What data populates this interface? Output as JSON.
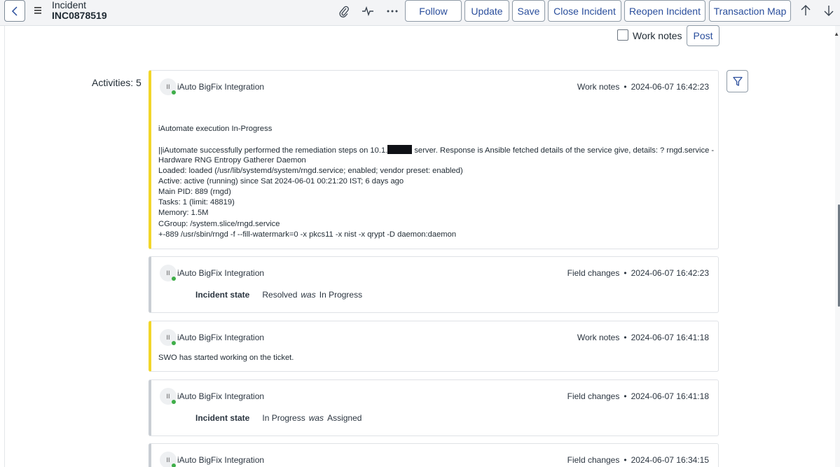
{
  "header": {
    "title": "Incident",
    "number": "INC0878519",
    "buttons": {
      "follow": "Follow",
      "update": "Update",
      "save": "Save",
      "close_incident": "Close Incident",
      "reopen_incident": "Reopen Incident",
      "transaction_map": "Transaction Map"
    },
    "icons": [
      "back-icon",
      "menu-icon",
      "paperclip-icon",
      "pulse-icon",
      "more-icon",
      "arrow-up-icon",
      "arrow-down-icon"
    ]
  },
  "compose": {
    "work_notes_label": "Work notes",
    "work_notes_checked": false,
    "post_label": "Post"
  },
  "activities": {
    "label": "Activities: 5",
    "entries": [
      {
        "avatar": "II",
        "author": "iAuto BigFix Integration",
        "type": "Work notes",
        "timestamp": "2024-06-07 16:42:23",
        "title": "iAutomate execution In-Progress",
        "line1_before": "||iAutomate successfully performed the remediation steps on 10.1.",
        "line1_after": "server. Response is Ansible fetched details of the service give, details: ? rngd.service -",
        "lines": [
          "Hardware RNG Entropy Gatherer Daemon",
          "Loaded: loaded (/usr/lib/systemd/system/rngd.service; enabled; vendor preset: enabled)",
          "Active: active (running) since Sat 2024-06-01 00:21:20 IST; 6 days ago",
          "Main PID: 889 (rngd)",
          "Tasks: 1 (limit: 48819)",
          "Memory: 1.5M",
          "CGroup: /system.slice/rngd.service",
          "+-889 /usr/sbin/rngd -f --fill-watermark=0 -x pkcs11 -x nist -x qrypt -D daemon:daemon"
        ]
      },
      {
        "avatar": "II",
        "author": "iAuto BigFix Integration",
        "type": "Field changes",
        "timestamp": "2024-06-07 16:42:23",
        "field": "Incident state",
        "new_value": "Resolved",
        "was_word": "was",
        "old_value": "In Progress"
      },
      {
        "avatar": "II",
        "author": "iAuto BigFix Integration",
        "type": "Work notes",
        "timestamp": "2024-06-07 16:41:18",
        "text": "SWO has started working on the ticket."
      },
      {
        "avatar": "II",
        "author": "iAuto BigFix Integration",
        "type": "Field changes",
        "timestamp": "2024-06-07 16:41:18",
        "field": "Incident state",
        "new_value": "In Progress",
        "was_word": "was",
        "old_value": "Assigned"
      },
      {
        "avatar": "II",
        "author": "iAuto BigFix Integration",
        "type": "Field changes",
        "timestamp": "2024-06-07 16:34:15"
      }
    ]
  },
  "colors": {
    "accent": "#2a4e9c",
    "worknote_bar": "#f2d629",
    "fieldchange_bar": "#c9ced4",
    "online_dot": "#3fae49"
  }
}
